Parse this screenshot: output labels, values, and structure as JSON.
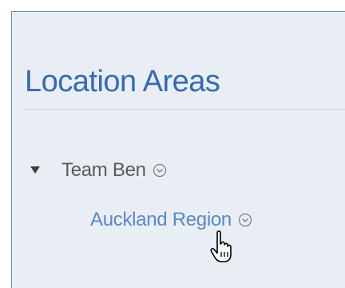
{
  "page": {
    "title": "Location Areas"
  },
  "tree": {
    "team": {
      "label": "Team Ben",
      "expanded": true,
      "toggle_icon": "caret-down-icon",
      "menu_icon": "chevron-down-circle-icon"
    },
    "region": {
      "label": "Auckland Region",
      "menu_icon": "chevron-down-circle-icon"
    }
  },
  "colors": {
    "title": "#3469b8",
    "link": "#5a88c8",
    "text": "#5b5b5b",
    "panel_bg": "#e9eef5"
  },
  "pointer": {
    "icon": "hand-pointer-icon"
  }
}
